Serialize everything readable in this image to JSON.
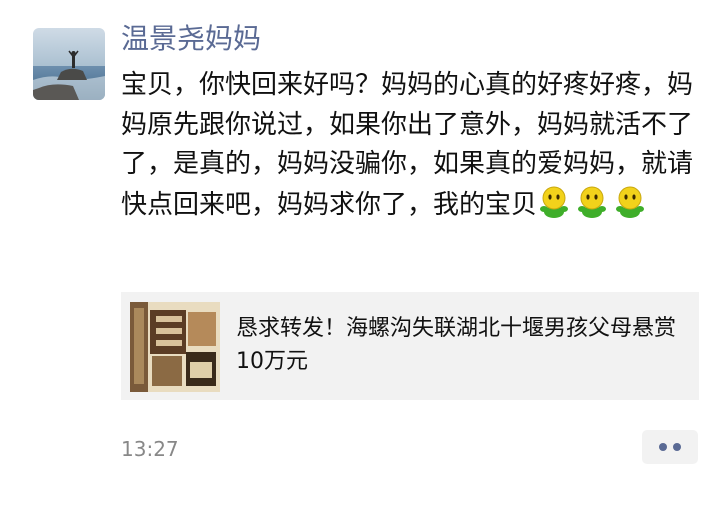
{
  "post": {
    "author": "温景尧妈妈",
    "text": "宝贝，你快回来好吗？妈妈的心真的好疼好疼，妈妈原先跟你说过，如果你出了意外，妈妈就活不了了，是真的，妈妈没骗你，如果真的爱妈妈，就请快点回来吧，妈妈求你了，我的宝贝",
    "emoji": [
      "green-smiley-emoji",
      "green-smiley-emoji",
      "green-smiley-emoji"
    ],
    "shared_link": {
      "title": "恳求转发！海螺沟失联湖北十堰男孩父母悬赏10万元"
    },
    "timestamp": "13:27"
  },
  "colors": {
    "author_name": "#5a6a94",
    "card_background": "#f2f2f2",
    "timestamp": "#888888"
  }
}
